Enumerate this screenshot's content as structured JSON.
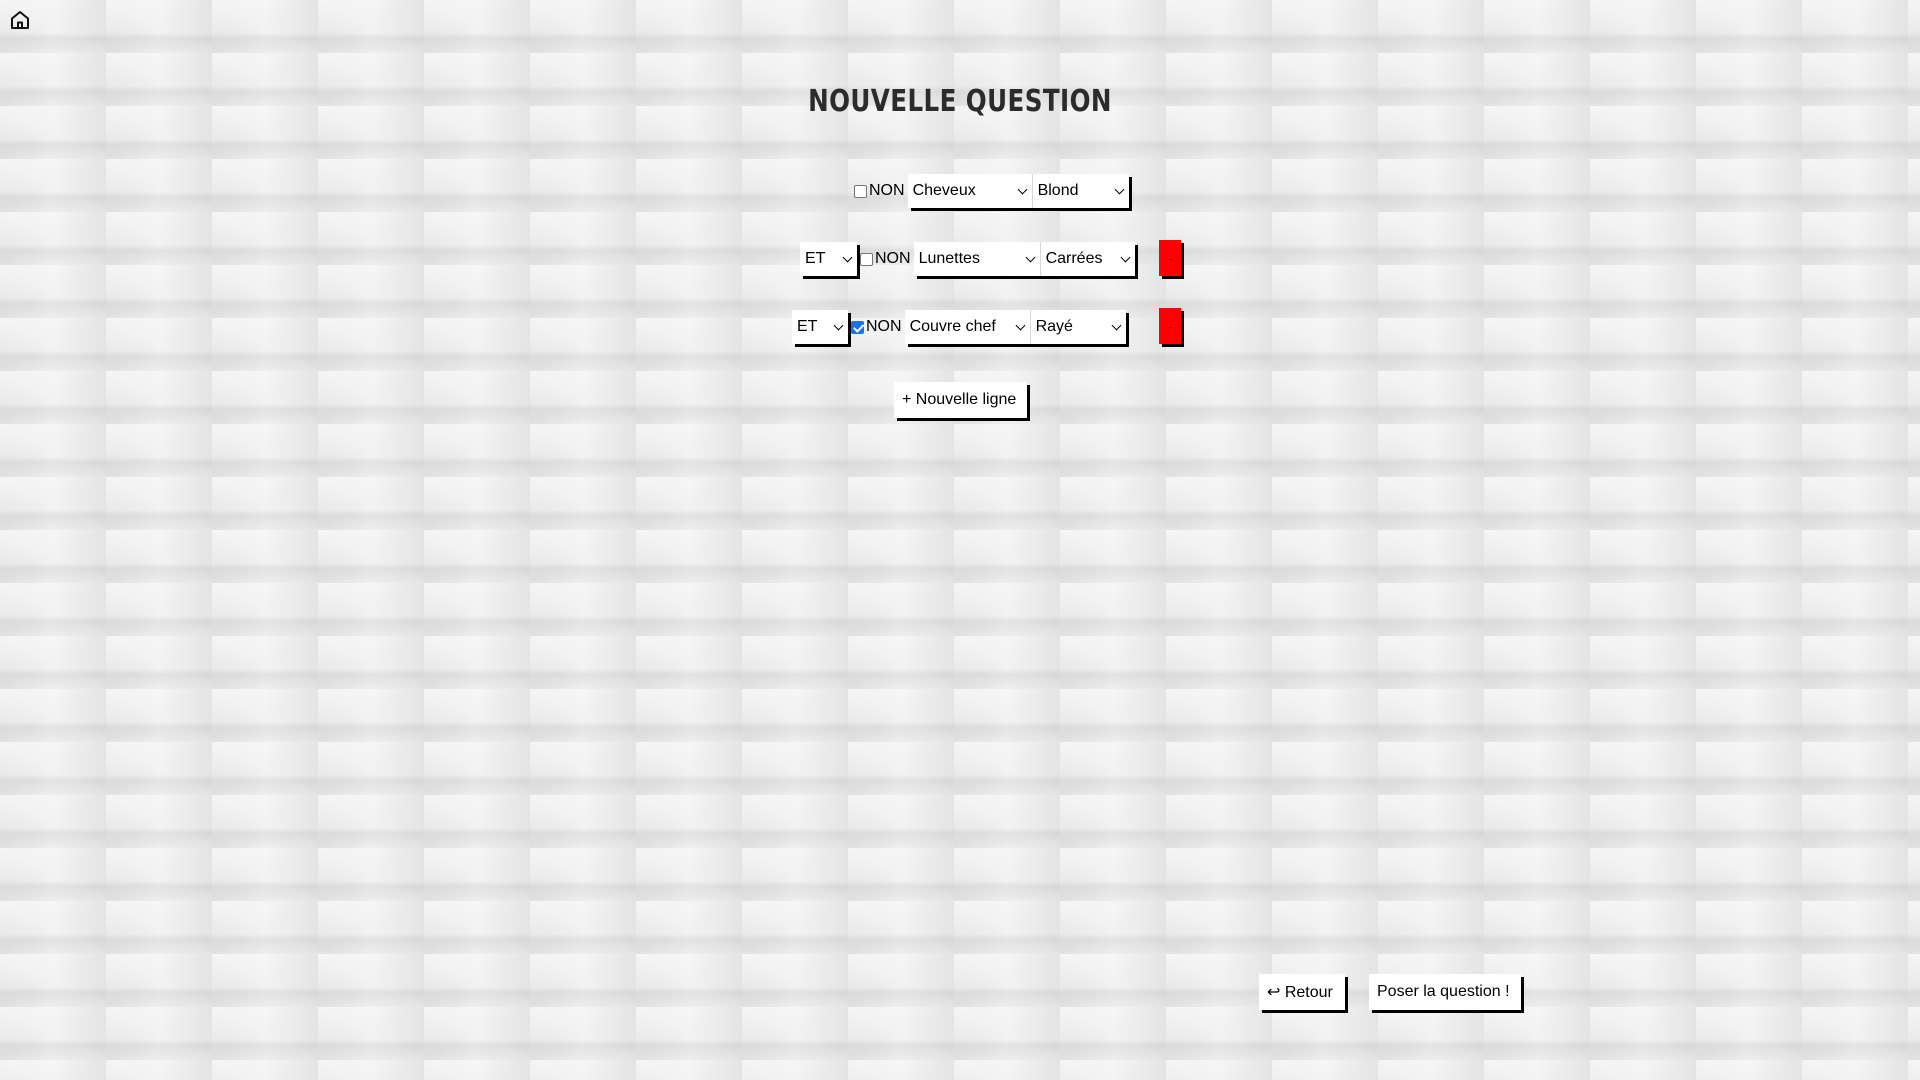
{
  "nav": {
    "home_icon": "home-icon"
  },
  "title": "NOUVELLE QUESTION",
  "rows": [
    {
      "negation_label": "NON",
      "negated": false,
      "attribute": "Cheveux",
      "value": "Blond"
    },
    {
      "connector": "ET",
      "negation_label": "NON",
      "negated": false,
      "attribute": "Lunettes",
      "value": "Carrées",
      "delete_label": "-"
    },
    {
      "connector": "ET",
      "negation_label": "NON",
      "negated": true,
      "attribute": "Couvre chef",
      "value": "Rayé",
      "delete_label": "-"
    }
  ],
  "add_row_label": "+ Nouvelle ligne",
  "footer": {
    "back_label": "↩ Retour",
    "submit_label": "Poser la question !"
  },
  "colors": {
    "delete_button": "#ff0000",
    "checkbox_checked": "#1a73e8"
  }
}
